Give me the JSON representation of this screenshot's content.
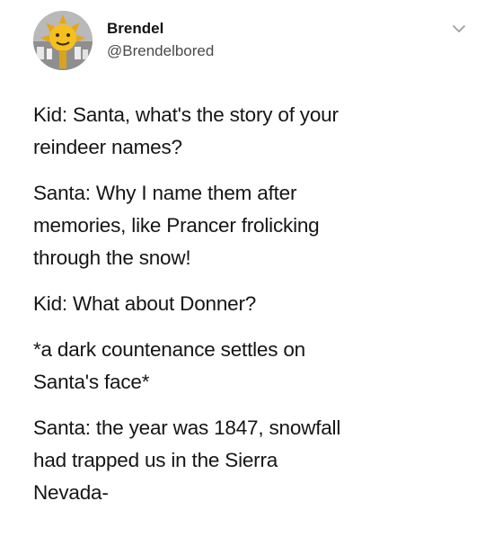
{
  "author": {
    "name": "Brendel",
    "handle": "@Brendelbored",
    "avatar_icon": "sun-face-avatar-icon",
    "menu_icon": "chevron-down-icon"
  },
  "tweet": {
    "paragraphs": [
      [
        "Kid: Santa, what's the story of your",
        "reindeer names?"
      ],
      [
        "Santa: Why I name them after",
        "memories, like Prancer frolicking",
        "through the snow!"
      ],
      [
        "Kid: What about Donner?"
      ],
      [
        "*a dark countenance settles on",
        "Santa's face*"
      ],
      [
        "Santa: the year was 1847, snowfall",
        "had trapped us in the  Sierra",
        "Nevada-"
      ]
    ]
  },
  "colors": {
    "text": "#141414",
    "handle": "#4a4a4a",
    "chevron": "#9a9a9a",
    "background": "#ffffff"
  }
}
